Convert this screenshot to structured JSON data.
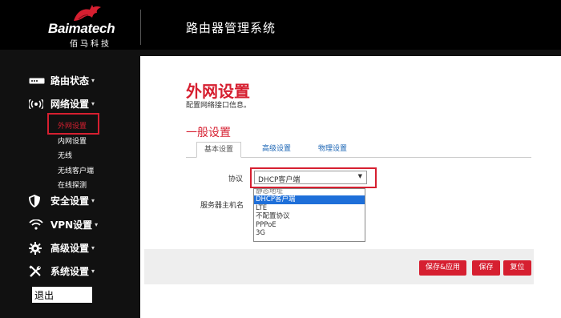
{
  "header": {
    "brand": "Baimatech",
    "brand_cn": "佰马科技",
    "system_title": "路由器管理系统"
  },
  "sidebar": {
    "items": [
      {
        "label": "路由状态",
        "caret": "▾",
        "icon": "router-icon"
      },
      {
        "label": "网络设置",
        "caret": "▾",
        "icon": "wireless-signal-icon"
      },
      {
        "label": "安全设置",
        "caret": "▾",
        "icon": "shield-icon"
      },
      {
        "label": "VPN设置",
        "caret": "▾",
        "icon": "wifi-icon"
      },
      {
        "label": "高级设置",
        "caret": "▾",
        "icon": "gear-icon"
      },
      {
        "label": "系统设置",
        "caret": "▾",
        "icon": "tools-icon"
      }
    ],
    "subitems": [
      "外网设置",
      "内网设置",
      "无线",
      "无线客户端",
      "在线探测"
    ],
    "active_subitem": "外网设置",
    "logout": "退出"
  },
  "main": {
    "title": "外网设置",
    "description": "配置网络接口信息。",
    "section_title": "一般设置",
    "tabs": [
      "基本设置",
      "高级设置",
      "物理设置"
    ],
    "active_tab": "基本设置",
    "fields": {
      "protocol_label": "协议",
      "protocol_value": "DHCP客户端",
      "hostname_label": "服务器主机名"
    },
    "protocol_options": [
      "静态地址",
      "DHCP客户端",
      "LTE",
      "不配置协议",
      "PPPoE",
      "3G"
    ],
    "buttons": {
      "save_apply": "保存&应用",
      "save": "保存",
      "reset": "复位"
    }
  },
  "colors": {
    "accent": "#d61f30",
    "link": "#1a64b4",
    "selected_option": "#1e6fd9",
    "sidebar_bg": "#111111"
  }
}
